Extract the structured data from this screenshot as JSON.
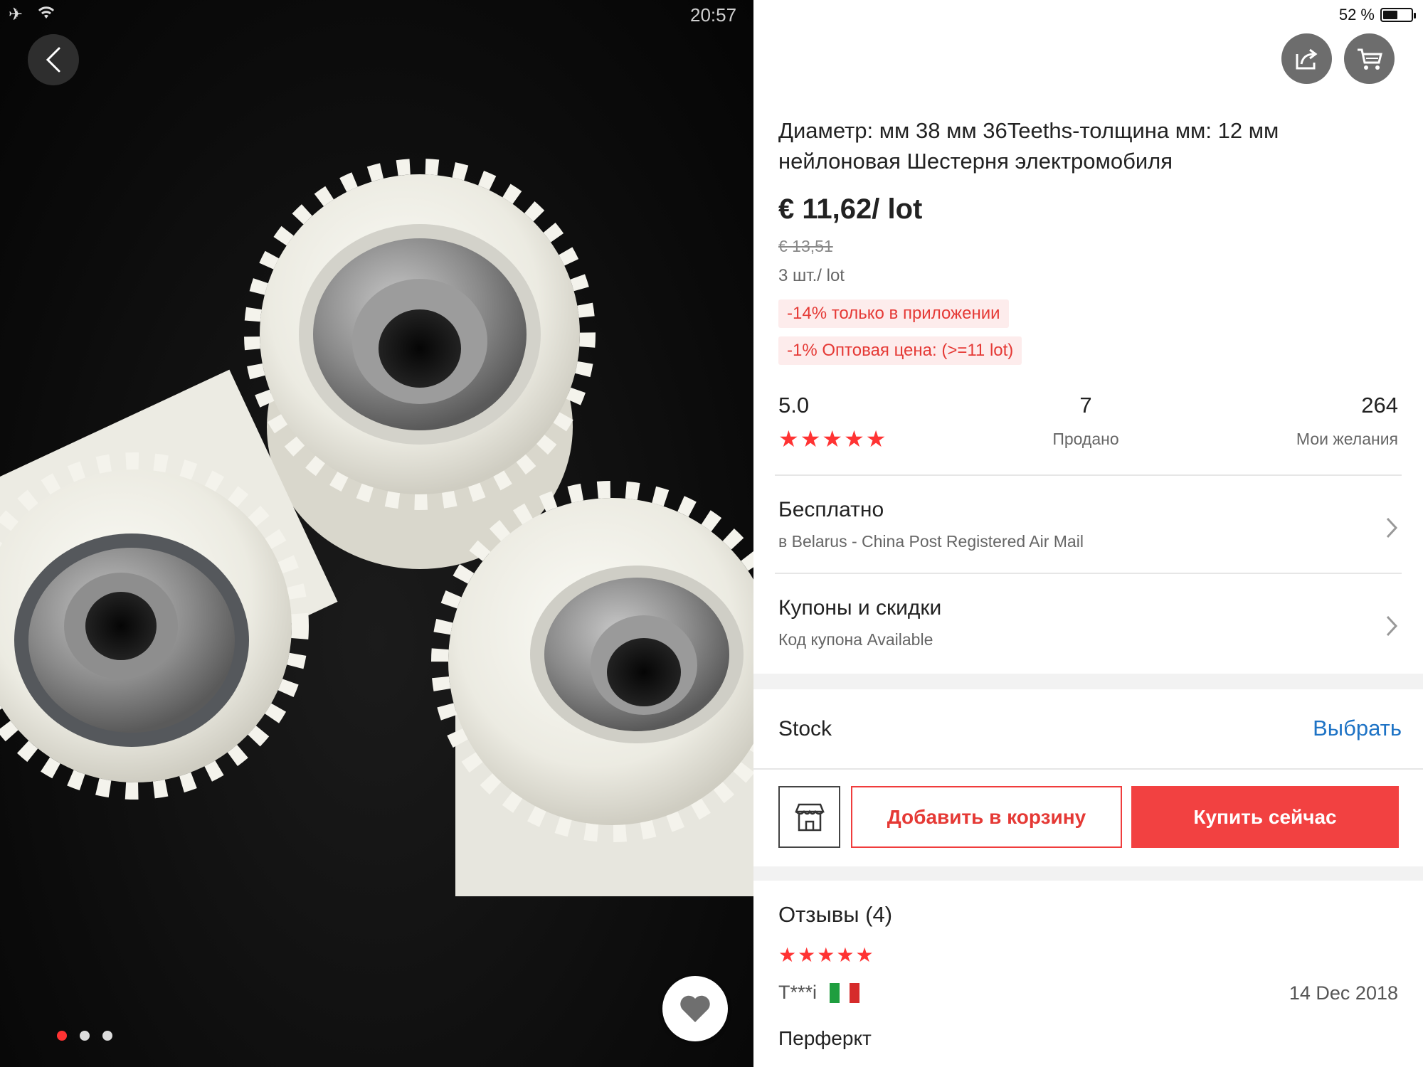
{
  "status_bar": {
    "time": "20:57",
    "battery_text": "52 %",
    "battery_level": 0.52,
    "left_icons": [
      "airplane-icon",
      "wifi-icon"
    ]
  },
  "gallery": {
    "page_count": 3,
    "active_page": 1,
    "icons": [
      "back-arrow-icon",
      "heart-icon"
    ]
  },
  "header_actions": [
    "share-icon",
    "cart-icon"
  ],
  "product": {
    "title": "Диаметр: мм 38 мм 36Teeths-толщина мм: 12 мм нейлоновая Шестерня электромобиля",
    "price": "€ 11,62/ lot",
    "old_price": "€ 13,51",
    "unit": "3 шт./ lot",
    "promos": [
      "-14% только в приложении",
      "-1% Оптовая цена: (>=11 lot)"
    ]
  },
  "stats": {
    "rating": "5.0",
    "rating_stars": 5,
    "sold_value": "7",
    "sold_label": "Продано",
    "wishlist_value": "264",
    "wishlist_label": "Мои желания"
  },
  "shipping": {
    "title": "Бесплатно",
    "subtitle": "в Belarus - China Post Registered Air Mail"
  },
  "coupons": {
    "title": "Купоны и скидки",
    "subtitle": "Код купона Available"
  },
  "stock": {
    "label": "Stock",
    "action": "Выбрать"
  },
  "actions": {
    "add_to_cart": "Добавить в корзину",
    "buy_now": "Купить сейчас",
    "accent_color": "#f24141"
  },
  "reviews": {
    "title": "Отзывы (4)",
    "first": {
      "stars": 5,
      "author": "T***i",
      "country_flag": "italy-flag",
      "date": "14 Dec 2018",
      "text": "Перферкт"
    }
  }
}
